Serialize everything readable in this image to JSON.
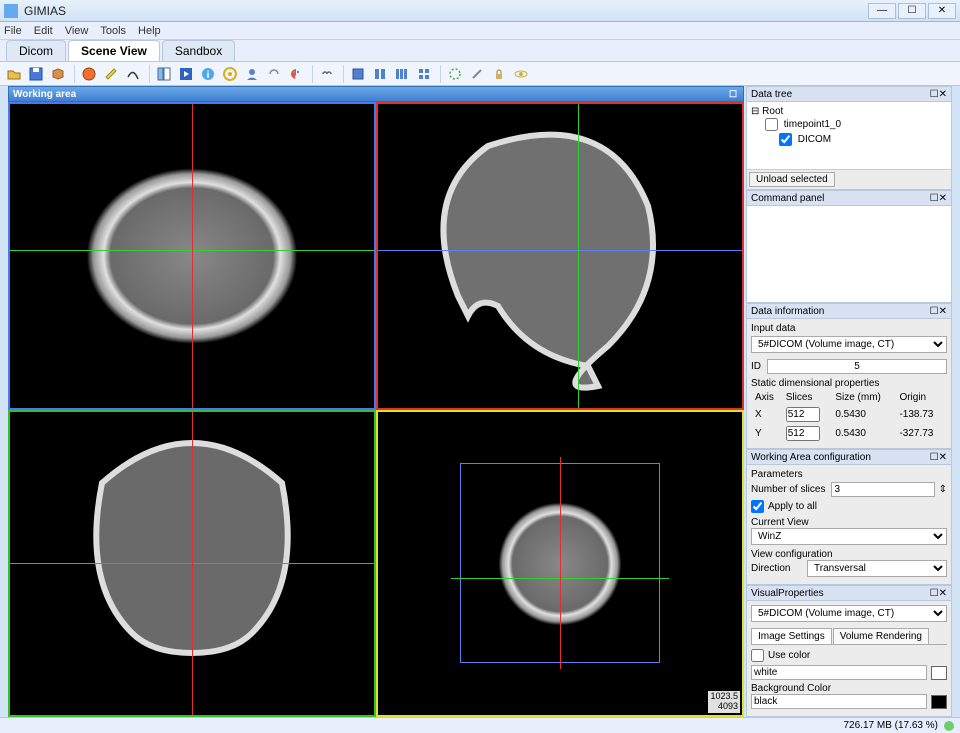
{
  "window": {
    "title": "GIMIAS"
  },
  "menu": {
    "items": [
      "File",
      "Edit",
      "View",
      "Tools",
      "Help"
    ]
  },
  "tabs": {
    "items": [
      "Dicom",
      "Scene View",
      "Sandbox"
    ],
    "active": 1
  },
  "workarea": {
    "title": "Working area"
  },
  "corner_labels": {
    "lvl1": "1023.5",
    "lvl2": "4093"
  },
  "sidebar": {
    "datatree": {
      "title": "Data tree",
      "root": "Root",
      "items": [
        {
          "label": "timepoint1_0",
          "checked": false
        },
        {
          "label": "DICOM",
          "checked": true
        }
      ],
      "unload_btn": "Unload selected"
    },
    "command": {
      "title": "Command panel"
    },
    "datainfo": {
      "title": "Data information",
      "input_label": "Input data",
      "input_value": "5#DICOM (Volume image, CT)",
      "id_label": "ID",
      "id_value": "5",
      "static_label": "Static dimensional properties",
      "columns": [
        "Axis",
        "Slices",
        "Size (mm)",
        "Origin"
      ],
      "rows": [
        [
          "X",
          "512",
          "0.5430",
          "-138.73"
        ],
        [
          "Y",
          "512",
          "0.5430",
          "-327.73"
        ]
      ]
    },
    "waconfig": {
      "title": "Working Area configuration",
      "params_label": "Parameters",
      "nslices_label": "Number of slices",
      "nslices_value": "3",
      "apply_label": "Apply to all",
      "apply_checked": true,
      "currentview_label": "Current View",
      "currentview_value": "WinZ",
      "viewconfig_label": "View configuration",
      "direction_label": "Direction",
      "direction_value": "Transversal"
    },
    "visual": {
      "title": "VisualProperties",
      "combo_value": "5#DICOM (Volume image, CT)",
      "tabs": [
        "Image Settings",
        "Volume Rendering"
      ],
      "active_tab": 0,
      "usecolor_label": "Use color",
      "fg_value": "white",
      "fg_swatch": "#ffffff",
      "bgcolor_label": "Background Color",
      "bg_value": "black",
      "bg_swatch": "#000000"
    }
  },
  "status": {
    "memory": "726.17 MB (17.63 %)"
  }
}
